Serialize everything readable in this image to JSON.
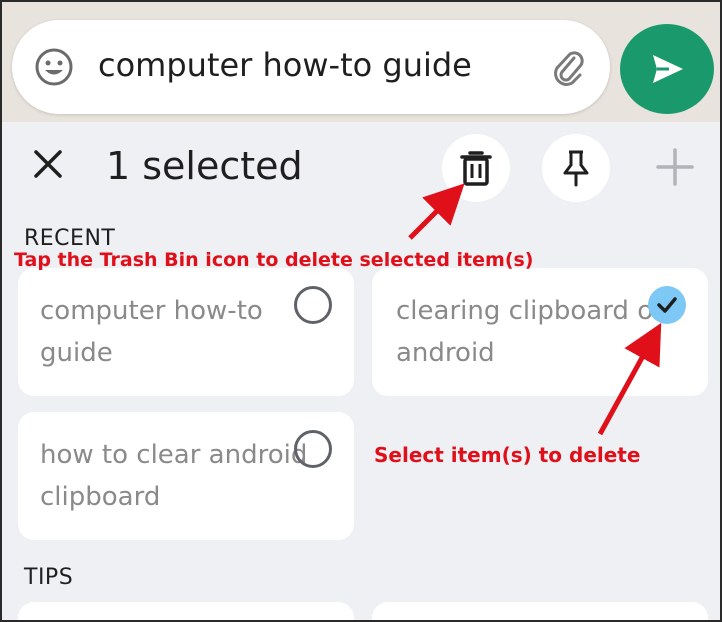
{
  "input": {
    "value": "computer how-to guide"
  },
  "toolbar": {
    "selected_label": "1 selected"
  },
  "sections": {
    "recent": "RECENT",
    "tips": "TIPS"
  },
  "clips": [
    {
      "text": "computer how-to\nguide",
      "selected": false
    },
    {
      "text": "clearing clipboard on\nandroid",
      "selected": true
    },
    {
      "text": "how to clear android\nclipboard",
      "selected": false
    }
  ],
  "annotations": {
    "trash_hint": "Tap the Trash Bin icon to delete selected item(s)",
    "select_hint": "Select item(s) to delete"
  },
  "colors": {
    "send": "#1a9a6c",
    "check": "#7ec8f6",
    "annotation": "#e0101a"
  },
  "icons": [
    "emoji-icon",
    "paperclip-icon",
    "send-icon",
    "close-icon",
    "trash-icon",
    "pin-icon",
    "plus-icon",
    "check-icon"
  ]
}
